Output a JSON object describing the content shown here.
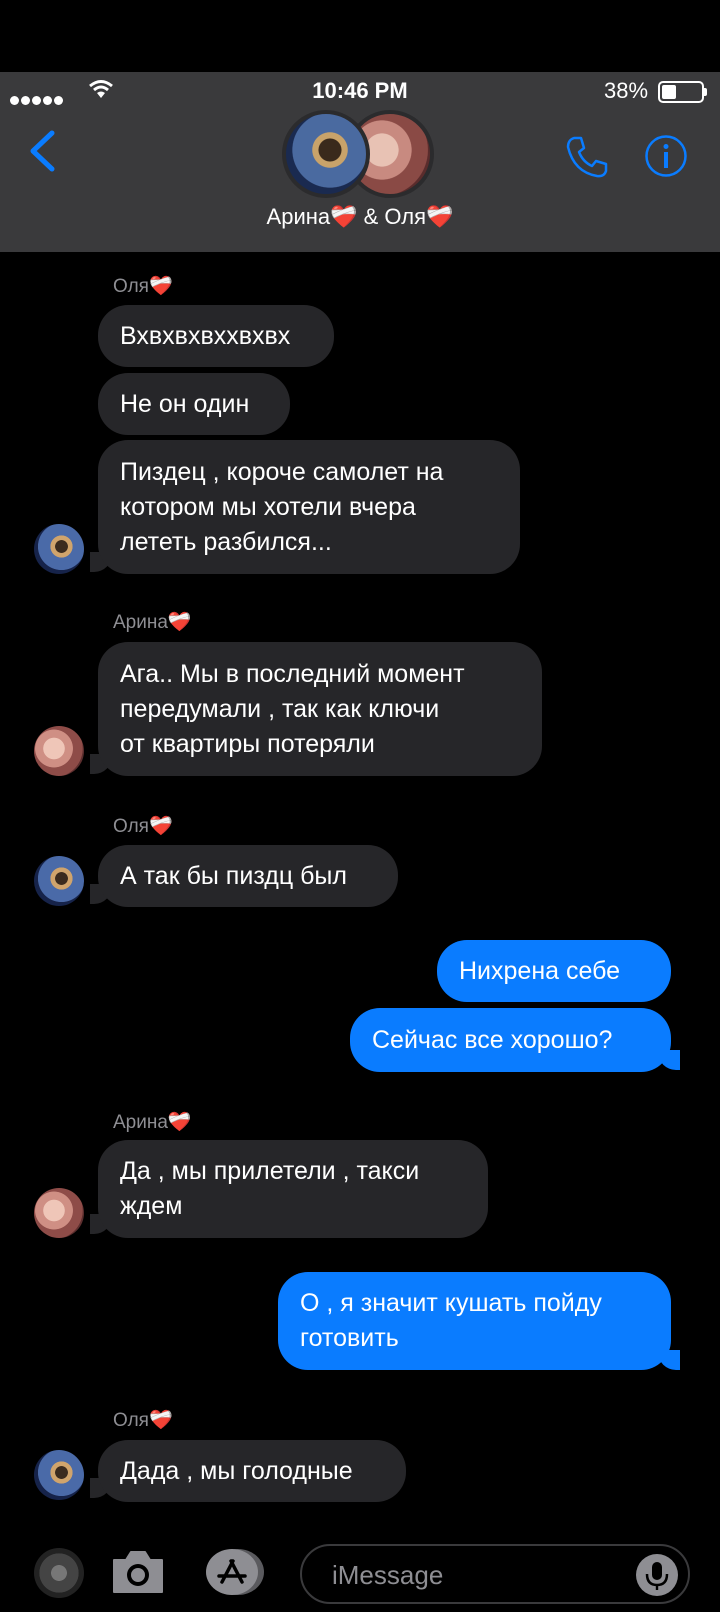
{
  "status": {
    "time": "10:46 PM",
    "battery": "38%",
    "battery_level": 0.38
  },
  "header": {
    "names": "Арина❤️‍🩹 & Оля❤️‍🩹"
  },
  "messages": [
    {
      "sender": "Оля❤️‍🩹"
    },
    {
      "text": "Вхвхвхвххвхвх"
    },
    {
      "text": "Не он один"
    },
    {
      "lines": [
        "Пиздец , короче самолет на",
        "котором мы хотели вчера",
        "лететь разбился..."
      ]
    },
    {
      "sender": "Арина❤️‍🩹"
    },
    {
      "lines": [
        "Ага.. Мы в последний момент",
        "передумали , так как ключи",
        "от квартиры потеряли"
      ]
    },
    {
      "sender": "Оля❤️‍🩹"
    },
    {
      "text": "А так бы пиздц был"
    },
    {
      "text": "Нихрена себе"
    },
    {
      "text": "Сейчас все хорошо?"
    },
    {
      "sender": "Арина❤️‍🩹"
    },
    {
      "lines": [
        "Да , мы прилетели , такси",
        "ждем"
      ]
    },
    {
      "lines": [
        "О , я значит кушать пойду",
        "готовить"
      ]
    },
    {
      "sender": "Оля❤️‍🩹"
    },
    {
      "text": "Дада , мы голодные"
    }
  ],
  "compose": {
    "placeholder": "iMessage"
  },
  "icons": {
    "back": "chevron-left-icon",
    "phone": "phone-icon",
    "info": "info-icon",
    "camera": "camera-icon",
    "appstore": "app-store-icon",
    "mic": "microphone-icon"
  }
}
